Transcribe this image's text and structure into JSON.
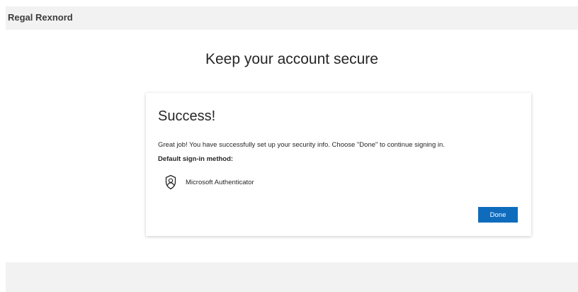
{
  "header": {
    "org_name": "Regal Rexnord"
  },
  "main": {
    "page_title": "Keep your account secure"
  },
  "card": {
    "title": "Success!",
    "message": "Great job! You have successfully set up your security info. Choose \"Done\" to continue signing in.",
    "method_label": "Default sign-in method:",
    "method": {
      "icon": "authenticator-icon",
      "name": "Microsoft Authenticator"
    },
    "done_label": "Done"
  },
  "colors": {
    "accent": "#0f6cbd",
    "bar_background": "#f2f2f2",
    "text": "#262626"
  }
}
